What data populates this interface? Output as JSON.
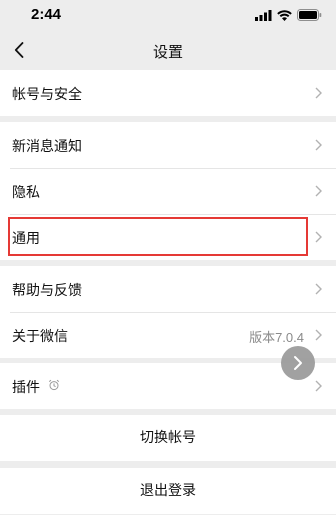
{
  "status_bar": {
    "time": "2:44"
  },
  "nav": {
    "title": "设置"
  },
  "groups": [
    {
      "items": [
        {
          "label": "帐号与安全"
        }
      ]
    },
    {
      "items": [
        {
          "label": "新消息通知"
        },
        {
          "label": "隐私"
        },
        {
          "label": "通用"
        }
      ]
    },
    {
      "items": [
        {
          "label": "帮助与反馈"
        },
        {
          "label": "关于微信",
          "value": "版本7.0.4"
        }
      ]
    },
    {
      "items": [
        {
          "label": "插件"
        }
      ]
    }
  ],
  "actions": {
    "switch_account": "切换帐号",
    "logout": "退出登录"
  },
  "icons": {
    "back": "chevron-left-icon",
    "chevron": "chevron-right-icon",
    "plugin": "alarm-icon",
    "float": "assistive-touch-icon"
  },
  "colors": {
    "highlight": "#e53935",
    "background": "#ededed"
  }
}
